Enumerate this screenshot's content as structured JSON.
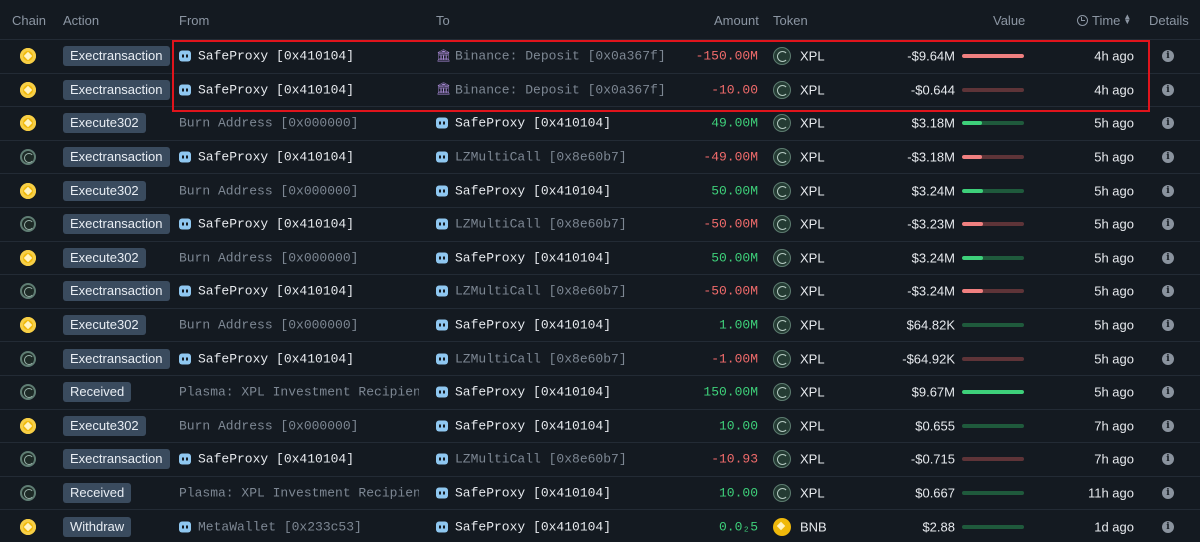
{
  "header": {
    "chain": "Chain",
    "action": "Action",
    "from": "From",
    "to": "To",
    "amount": "Amount",
    "token": "Token",
    "value": "Value",
    "time": "Time",
    "details": "Details"
  },
  "colors": {
    "background": "#141a21",
    "negative": "#f06b6b",
    "positive": "#3ed07a",
    "highlight": "#e0141c",
    "badge": "#3a4b5e"
  },
  "rows": [
    {
      "chain": "bnb",
      "action": "Exectransaction",
      "from": "SafeProxy [0x410104]",
      "from_icon": "bot",
      "to": "Binance: Deposit [0x0a367f]",
      "to_icon": "bank",
      "amount": "-150.00M",
      "amount_sign": "neg",
      "token": "XPL",
      "token_icon": "xpl",
      "value": "-$9.64M",
      "bar_fraction": 1.0,
      "time": "4h ago"
    },
    {
      "chain": "bnb",
      "action": "Exectransaction",
      "from": "SafeProxy [0x410104]",
      "from_icon": "bot",
      "to": "Binance: Deposit [0x0a367f]",
      "to_icon": "bank",
      "amount": "-10.00",
      "amount_sign": "neg",
      "token": "XPL",
      "token_icon": "xpl",
      "value": "-$0.644",
      "bar_fraction": 0.0,
      "time": "4h ago"
    },
    {
      "chain": "bnb",
      "action": "Execute302",
      "from": "Burn Address [0x000000]",
      "from_icon": "",
      "to": "SafeProxy [0x410104]",
      "to_icon": "bot",
      "amount": "49.00M",
      "amount_sign": "pos",
      "token": "XPL",
      "token_icon": "xpl",
      "value": "$3.18M",
      "bar_fraction": 0.33,
      "time": "5h ago"
    },
    {
      "chain": "plasma",
      "action": "Exectransaction",
      "from": "SafeProxy [0x410104]",
      "from_icon": "bot",
      "to": "LZMultiCall [0x8e60b7]",
      "to_icon": "bot",
      "amount": "-49.00M",
      "amount_sign": "neg",
      "token": "XPL",
      "token_icon": "xpl",
      "value": "-$3.18M",
      "bar_fraction": 0.33,
      "time": "5h ago"
    },
    {
      "chain": "bnb",
      "action": "Execute302",
      "from": "Burn Address [0x000000]",
      "from_icon": "",
      "to": "SafeProxy [0x410104]",
      "to_icon": "bot",
      "amount": "50.00M",
      "amount_sign": "pos",
      "token": "XPL",
      "token_icon": "xpl",
      "value": "$3.24M",
      "bar_fraction": 0.34,
      "time": "5h ago"
    },
    {
      "chain": "plasma",
      "action": "Exectransaction",
      "from": "SafeProxy [0x410104]",
      "from_icon": "bot",
      "to": "LZMultiCall [0x8e60b7]",
      "to_icon": "bot",
      "amount": "-50.00M",
      "amount_sign": "neg",
      "token": "XPL",
      "token_icon": "xpl",
      "value": "-$3.23M",
      "bar_fraction": 0.34,
      "time": "5h ago"
    },
    {
      "chain": "bnb",
      "action": "Execute302",
      "from": "Burn Address [0x000000]",
      "from_icon": "",
      "to": "SafeProxy [0x410104]",
      "to_icon": "bot",
      "amount": "50.00M",
      "amount_sign": "pos",
      "token": "XPL",
      "token_icon": "xpl",
      "value": "$3.24M",
      "bar_fraction": 0.34,
      "time": "5h ago"
    },
    {
      "chain": "plasma",
      "action": "Exectransaction",
      "from": "SafeProxy [0x410104]",
      "from_icon": "bot",
      "to": "LZMultiCall [0x8e60b7]",
      "to_icon": "bot",
      "amount": "-50.00M",
      "amount_sign": "neg",
      "token": "XPL",
      "token_icon": "xpl",
      "value": "-$3.24M",
      "bar_fraction": 0.34,
      "time": "5h ago"
    },
    {
      "chain": "bnb",
      "action": "Execute302",
      "from": "Burn Address [0x000000]",
      "from_icon": "",
      "to": "SafeProxy [0x410104]",
      "to_icon": "bot",
      "amount": "1.00M",
      "amount_sign": "pos",
      "token": "XPL",
      "token_icon": "xpl",
      "value": "$64.82K",
      "bar_fraction": 0.0,
      "time": "5h ago"
    },
    {
      "chain": "plasma",
      "action": "Exectransaction",
      "from": "SafeProxy [0x410104]",
      "from_icon": "bot",
      "to": "LZMultiCall [0x8e60b7]",
      "to_icon": "bot",
      "amount": "-1.00M",
      "amount_sign": "neg",
      "token": "XPL",
      "token_icon": "xpl",
      "value": "-$64.92K",
      "bar_fraction": 0.0,
      "time": "5h ago"
    },
    {
      "chain": "plasma",
      "action": "Received",
      "from": "Plasma: XPL Investment Recipient …",
      "from_icon": "",
      "to": "SafeProxy [0x410104]",
      "to_icon": "bot",
      "amount": "150.00M",
      "amount_sign": "pos",
      "token": "XPL",
      "token_icon": "xpl",
      "value": "$9.67M",
      "bar_fraction": 1.0,
      "time": "5h ago"
    },
    {
      "chain": "bnb",
      "action": "Execute302",
      "from": "Burn Address [0x000000]",
      "from_icon": "",
      "to": "SafeProxy [0x410104]",
      "to_icon": "bot",
      "amount": "10.00",
      "amount_sign": "pos",
      "token": "XPL",
      "token_icon": "xpl",
      "value": "$0.655",
      "bar_fraction": 0.0,
      "time": "7h ago"
    },
    {
      "chain": "plasma",
      "action": "Exectransaction",
      "from": "SafeProxy [0x410104]",
      "from_icon": "bot",
      "to": "LZMultiCall [0x8e60b7]",
      "to_icon": "bot",
      "amount": "-10.93",
      "amount_sign": "neg",
      "token": "XPL",
      "token_icon": "xpl",
      "value": "-$0.715",
      "bar_fraction": 0.0,
      "time": "7h ago"
    },
    {
      "chain": "plasma",
      "action": "Received",
      "from": "Plasma: XPL Investment Recipient …",
      "from_icon": "",
      "to": "SafeProxy [0x410104]",
      "to_icon": "bot",
      "amount": "10.00",
      "amount_sign": "pos",
      "token": "XPL",
      "token_icon": "xpl",
      "value": "$0.667",
      "bar_fraction": 0.0,
      "time": "11h ago"
    },
    {
      "chain": "bnb",
      "action": "Withdraw",
      "from": "MetaWallet [0x233c53]",
      "from_icon": "bot",
      "from_dim": true,
      "to": "SafeProxy [0x410104]",
      "to_icon": "bot",
      "amount": "0.0₂5",
      "amount_sign": "pos",
      "token": "BNB",
      "token_icon": "bnb",
      "value": "$2.88",
      "bar_fraction": 0.0,
      "time": "1d ago"
    }
  ]
}
